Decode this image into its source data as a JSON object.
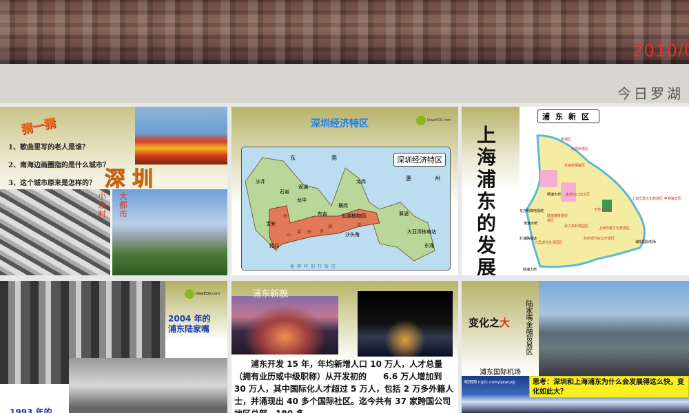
{
  "top_photo": {
    "date_stamp": "2010/0",
    "caption": "今日罗湖"
  },
  "slide1": {
    "title": "猜一猜",
    "questions": [
      "1、歌曲里写的老人是谁？",
      "2、南海边画圈指的是什么城市？",
      "3、这个城市原来是怎样的？"
    ],
    "answer": "深圳",
    "label_old": "小渔村",
    "label_new": "大都市"
  },
  "slide2": {
    "title": "深圳经济特区",
    "map_title": "深圳经济特区",
    "logo": "DearEDU.com",
    "places": [
      "东",
      "莞",
      "惠",
      "州",
      "沙井",
      "石岩",
      "观澜",
      "龙华",
      "布吉",
      "龙岗",
      "横岗",
      "仙湖植物园",
      "葵涌",
      "宝安",
      "蛇口",
      "沙头角",
      "大亚湾核电站",
      "东涌",
      "南",
      "山",
      "福",
      "田",
      "罗",
      "湖",
      "盐",
      "香港特别行政区"
    ]
  },
  "slide3": {
    "title": "上海浦东的发展",
    "map_title": "浦东新区",
    "places": [
      "新港区",
      "外高桥港区",
      "外高桥保税区",
      "杨浦大桥",
      "金桥出口加工区",
      "东方明珠电视塔",
      "陆家嘴金融贸易区",
      "南浦大桥",
      "张江高科技园区",
      "王桥工业区",
      "打浦路隧道",
      "六里现代生活园区",
      "孙桥现代农业开发区",
      "上海华夏文化旅游区",
      "上海华夏文化旅游区 甲港海滨区",
      "浦东国际机场",
      "徐浦大桥"
    ]
  },
  "slide4": {
    "logo": "DearEDU.com",
    "label_2004": "2004 年的\n浦东陆家嘴",
    "label_1993": "1993 年的"
  },
  "slide5": {
    "title": "浦东新貌",
    "body": "浦东开发 15 年，年均新增人口 10 万人，人才总量（拥有业历或中级职称）从开发初的　　6.6 万人增加到 30 万人，其中国际化人才超过 5 万人，包括 2 万多外籍人士，并涌现出 40 多个国际社区。迄今共有 37 家跨国公司地区总部，180 多"
  },
  "slide6": {
    "title_prefix": "变化之",
    "title_highlight": "大",
    "vertical_label": "陆家嘴金融贸易区",
    "airport": "浦东国际机场",
    "watermark": "昵图网 nipic.com/qxwuxp",
    "question": "思考：深圳和上海浦东为什么会发展得这么快，变化如此大？"
  }
}
